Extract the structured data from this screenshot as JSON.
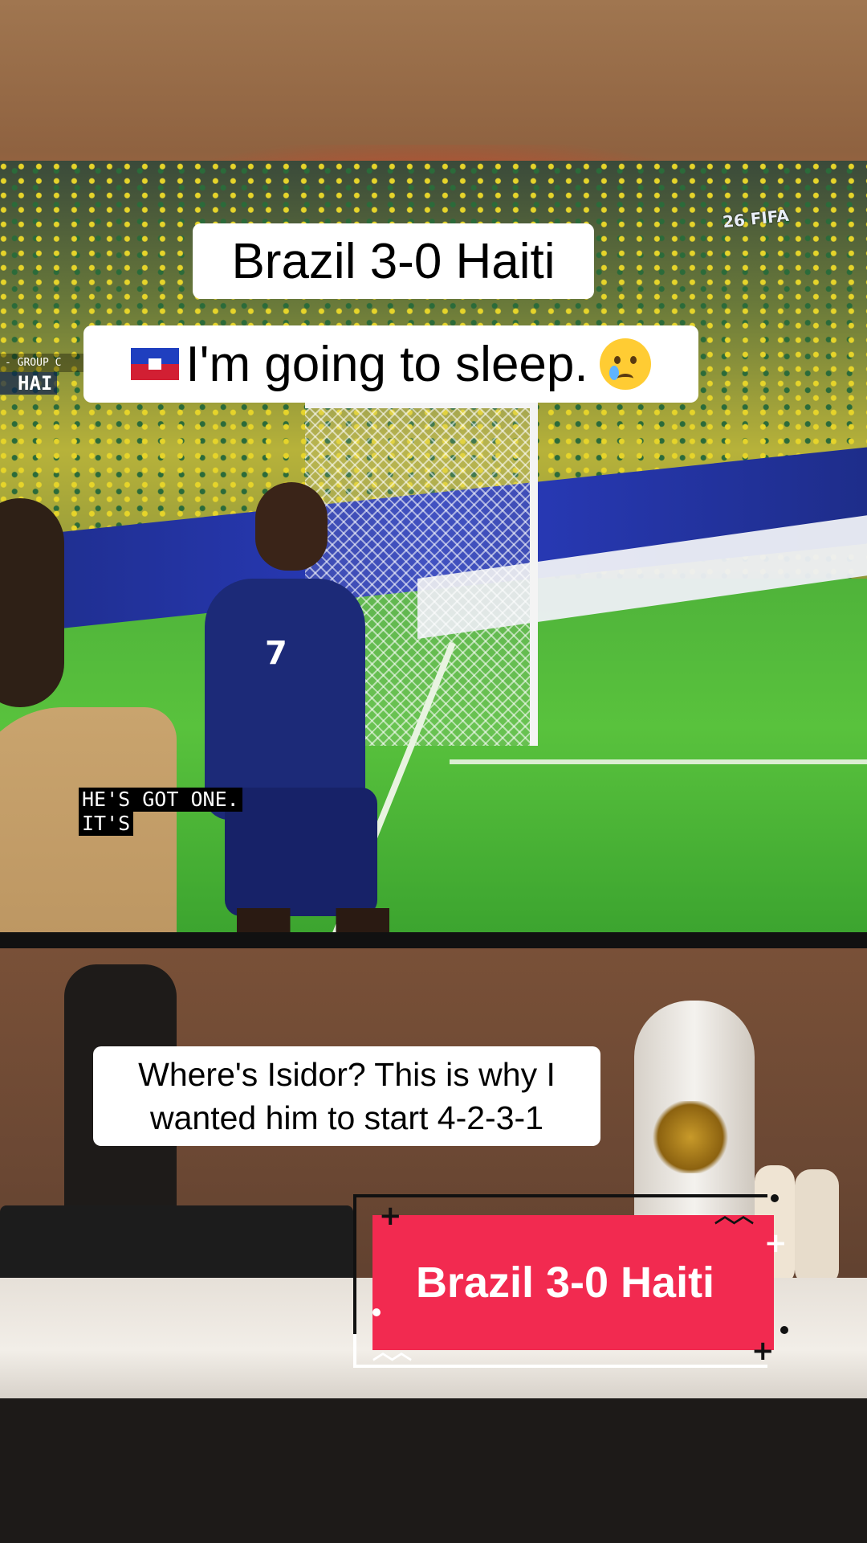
{
  "overlay": {
    "title": "Brazil 3-0 Haiti",
    "sleep_text": "I'm going to sleep.",
    "flag_icon": "haiti-flag-icon",
    "emoji_icon": "crying-face-icon",
    "comment_line1": "Where's Isidor? This is why I",
    "comment_line2": "wanted him to start 4-2-3-1",
    "sticker_text": "Brazil 3-0 Haiti"
  },
  "tv": {
    "score_group": "- GROUP C",
    "score_team": "HAI",
    "player_number": "7",
    "caption_line1": "HE'S GOT ONE.",
    "caption_line2": "IT'S"
  },
  "colors": {
    "sticker_fill": "#f22a50",
    "tv_glow": "#ff2a1a"
  }
}
